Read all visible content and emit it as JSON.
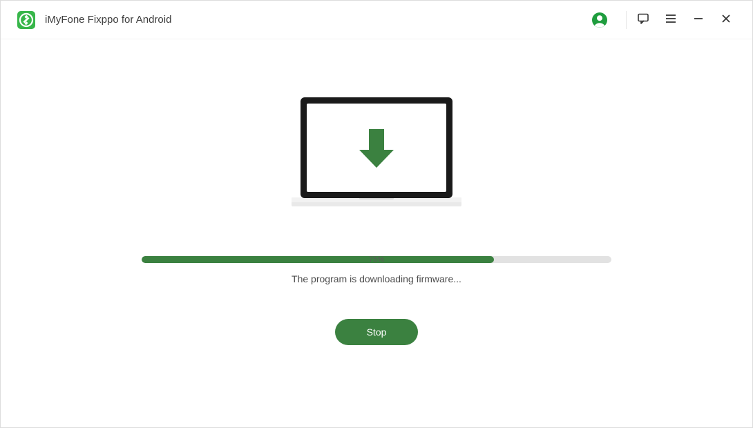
{
  "app": {
    "title": "iMyFone Fixppo for Android"
  },
  "progress": {
    "percent_value": 75,
    "percent_label": "75%",
    "status_text": "The program is downloading firmware..."
  },
  "actions": {
    "stop_label": "Stop"
  },
  "colors": {
    "brand_green": "#3b8140",
    "icon_green": "#1f9d3e"
  }
}
